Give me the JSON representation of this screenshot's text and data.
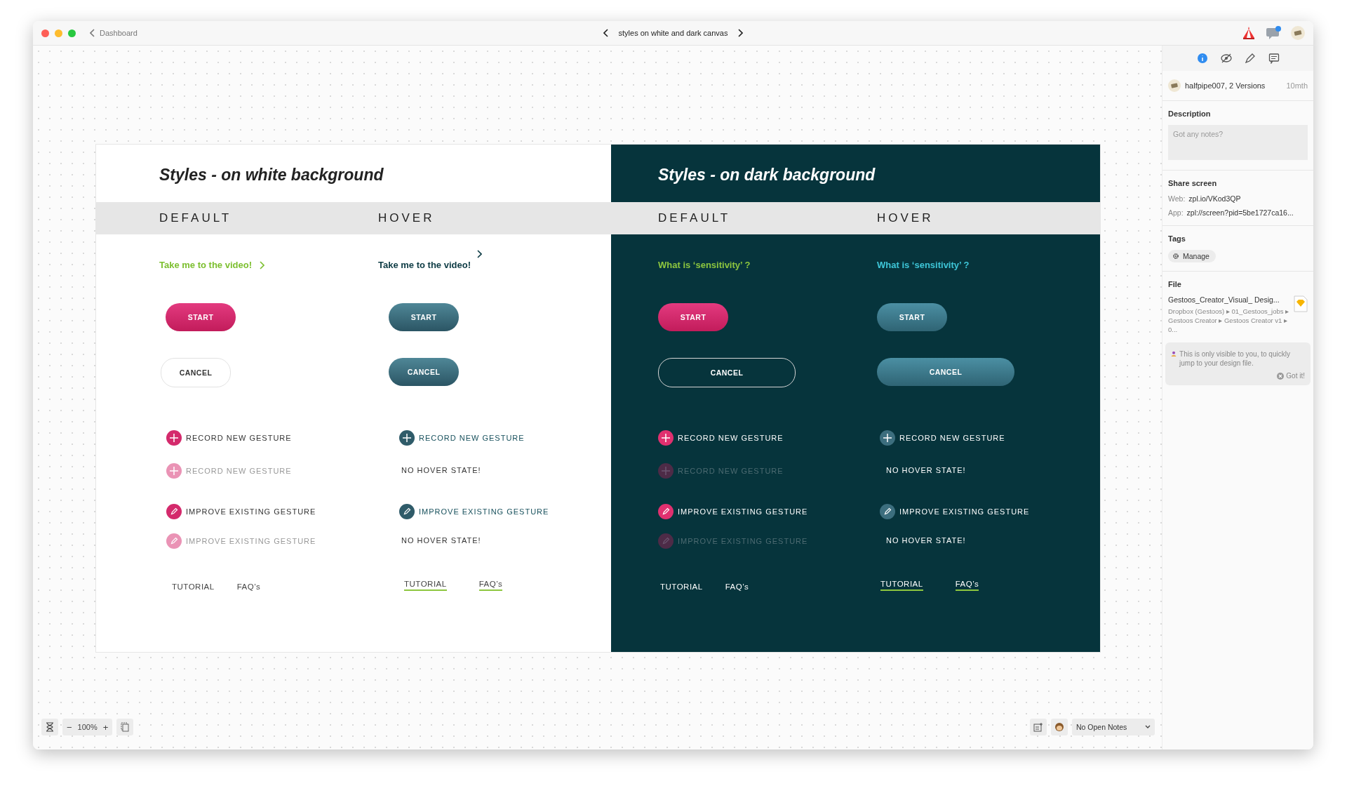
{
  "window": {
    "back_link": "Dashboard",
    "title": "styles on white and dark canvas"
  },
  "artboard": {
    "panels": [
      {
        "title": "Styles - on white background",
        "dark": false,
        "columns": [
          {
            "heading": "DEFAULT",
            "items": [
              {
                "kind": "link",
                "text": "Take me to the video!"
              },
              {
                "kind": "button",
                "text": "START",
                "wide": false
              },
              {
                "kind": "outline_button",
                "text": "CANCEL",
                "wide": false
              },
              {
                "kind": "add_action",
                "text": "RECORD NEW GESTURE",
                "disabled": false
              },
              {
                "kind": "add_action",
                "text": "RECORD NEW GESTURE",
                "disabled": true
              },
              {
                "kind": "edit_action",
                "text": "IMPROVE EXISTING GESTURE",
                "disabled": false
              },
              {
                "kind": "edit_action",
                "text": "IMPROVE EXISTING GESTURE",
                "disabled": true
              },
              {
                "kind": "nav",
                "links": [
                  {
                    "text": "TUTORIAL",
                    "underlined": false
                  },
                  {
                    "text": "FAQ’s",
                    "underlined": false
                  }
                ]
              }
            ]
          },
          {
            "heading": "HOVER",
            "items": [
              {
                "kind": "link",
                "text": "Take me to the video!"
              },
              {
                "kind": "button",
                "text": "START",
                "wide": false
              },
              {
                "kind": "button",
                "text": "CANCEL",
                "wide": false
              },
              {
                "kind": "add_action",
                "text": "RECORD NEW GESTURE",
                "disabled": false
              },
              {
                "kind": "note",
                "text": "NO HOVER STATE!"
              },
              {
                "kind": "edit_action",
                "text": "IMPROVE EXISTING GESTURE",
                "disabled": false
              },
              {
                "kind": "note",
                "text": "NO HOVER STATE!"
              },
              {
                "kind": "nav",
                "links": [
                  {
                    "text": "TUTORIAL",
                    "underlined": true
                  },
                  {
                    "text": "FAQ’s",
                    "underlined": true
                  }
                ]
              }
            ]
          }
        ]
      },
      {
        "title": "Styles - on dark  background",
        "dark": true,
        "columns": [
          {
            "heading": "DEFAULT",
            "items": [
              {
                "kind": "link",
                "text": "What is ‘sensitivity’ ?"
              },
              {
                "kind": "button",
                "text": "START",
                "wide": false
              },
              {
                "kind": "outline_button",
                "text": "CANCEL",
                "wide": true
              },
              {
                "kind": "add_action",
                "text": "RECORD NEW GESTURE",
                "disabled": false
              },
              {
                "kind": "add_action",
                "text": "RECORD NEW GESTURE",
                "disabled": true
              },
              {
                "kind": "edit_action",
                "text": "IMPROVE EXISTING GESTURE",
                "disabled": false
              },
              {
                "kind": "edit_action",
                "text": "IMPROVE EXISTING GESTURE",
                "disabled": true
              },
              {
                "kind": "nav",
                "links": [
                  {
                    "text": "TUTORIAL",
                    "underlined": false
                  },
                  {
                    "text": "FAQ’s",
                    "underlined": false
                  }
                ]
              }
            ]
          },
          {
            "heading": "HOVER",
            "items": [
              {
                "kind": "link",
                "text": "What is ‘sensitivity’ ?"
              },
              {
                "kind": "button",
                "text": "START",
                "wide": false
              },
              {
                "kind": "button",
                "text": "CANCEL",
                "wide": true
              },
              {
                "kind": "add_action",
                "text": "RECORD NEW GESTURE",
                "disabled": false
              },
              {
                "kind": "note",
                "text": "NO HOVER STATE!"
              },
              {
                "kind": "edit_action",
                "text": "IMPROVE EXISTING GESTURE",
                "disabled": false
              },
              {
                "kind": "note",
                "text": "NO HOVER STATE!"
              },
              {
                "kind": "nav",
                "links": [
                  {
                    "text": "TUTORIAL",
                    "underlined": true
                  },
                  {
                    "text": "FAQ’s",
                    "underlined": true
                  }
                ]
              }
            ]
          }
        ]
      }
    ]
  },
  "sidebar": {
    "tabs": [
      {
        "selected": true
      },
      {
        "selected": false
      },
      {
        "selected": false
      },
      {
        "selected": false
      }
    ],
    "version": {
      "author": "halfpipe007, 2 Versions",
      "age": "10mth"
    },
    "description": {
      "label": "Description",
      "placeholder": "Got any notes?"
    },
    "share": {
      "label": "Share screen",
      "links": [
        {
          "label": "Web:",
          "value": "zpl.io/VKod3QP"
        },
        {
          "label": "App:",
          "value": "zpl://screen?pid=5be1727ca16..."
        }
      ]
    },
    "tags": {
      "label": "Tags",
      "button": "Manage"
    },
    "file": {
      "label": "File",
      "name": "Gestoos_Creator_Visual_ Desig...",
      "path": "Dropbox (Gestoos) ▸ 01_Gestoos_jobs ▸ Gestoos Creator ▸ Gestoos Creator v1 ▸ 0...",
      "notice": "This is only visible to you, to quickly jump to your design file.",
      "dismiss": "Got it!"
    }
  },
  "zoom_bar": {
    "zoom_out": "−",
    "level_text": "100%",
    "zoom_in": "+"
  },
  "notes_dropdown": {
    "value": "No Open Notes"
  }
}
